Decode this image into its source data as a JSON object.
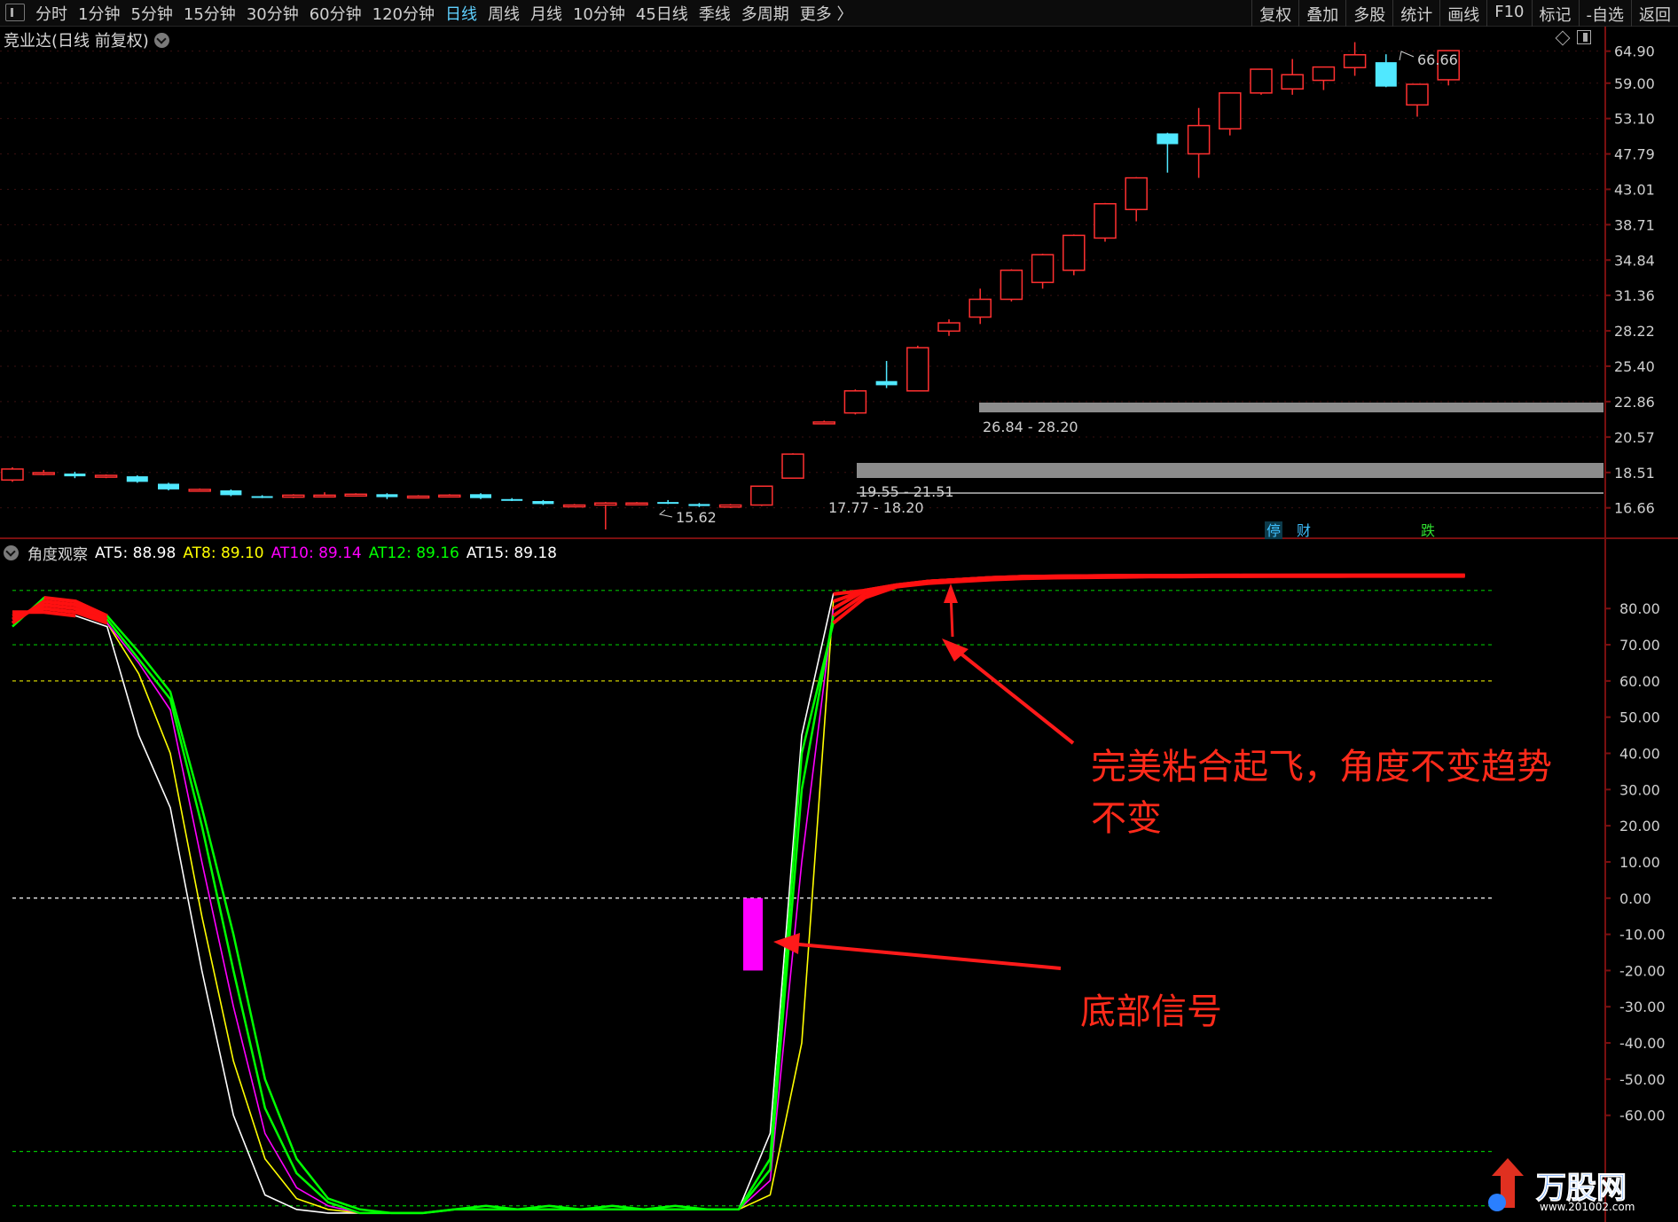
{
  "toolbar": {
    "periods": [
      "分时",
      "1分钟",
      "5分钟",
      "15分钟",
      "30分钟",
      "60分钟",
      "120分钟",
      "日线",
      "周线",
      "月线",
      "10分钟",
      "45日线",
      "季线",
      "多周期",
      "更多 〉"
    ],
    "active_period": "日线",
    "tools": [
      "复权",
      "叠加",
      "多股",
      "统计",
      "画线",
      "F10",
      "标记",
      "-自选",
      "返回"
    ]
  },
  "stock": {
    "name": "竞业达",
    "mode": "(日线 前复权)"
  },
  "price_axis": {
    "ticks": [
      "64.90",
      "59.00",
      "53.10",
      "47.79",
      "43.01",
      "38.71",
      "34.84",
      "31.36",
      "28.22",
      "25.40",
      "22.86",
      "20.57",
      "18.51",
      "16.66"
    ]
  },
  "price_annotations": {
    "high_label": "66.66",
    "low_label": "15.62",
    "gap1": "26.84 - 28.20",
    "gap2": "19.55 - 21.51",
    "gap3": "17.77 - 18.20"
  },
  "event_tags": {
    "tag1": "停",
    "tag2": "财",
    "tag3": "跌"
  },
  "indicator": {
    "name": "角度观察",
    "at5": "AT5: 88.98",
    "at8": "AT8: 89.10",
    "at10": "AT10: 89.14",
    "at12": "AT12: 89.16",
    "at15": "AT15: 89.18",
    "colors": {
      "at5": "#ffffff",
      "at8": "#ffff00",
      "at10": "#ff00ff",
      "at12": "#00ff00",
      "at15": "#ffffff"
    },
    "ticks": [
      "80.00",
      "70.00",
      "60.00",
      "50.00",
      "40.00",
      "30.00",
      "20.00",
      "10.00",
      "0.00",
      "-10.00",
      "-20.00",
      "-30.00",
      "-40.00",
      "-50.00",
      "-60.00"
    ]
  },
  "annotations": {
    "flight_line1": "完美粘合起飞，角度不变趋势",
    "flight_line2": "不变",
    "bottom_signal": "底部信号"
  },
  "logo": {
    "name": "万股网",
    "url": "www.201002.com"
  },
  "chart_data": [
    {
      "type": "candlestick",
      "title": "竞业达(日线 前复权)",
      "ylim": [
        15.5,
        68
      ],
      "y_scale": "log",
      "candles": [
        {
          "o": 18.1,
          "c": 18.7,
          "h": 18.8,
          "l": 18.0
        },
        {
          "o": 18.5,
          "c": 18.5,
          "h": 18.65,
          "l": 18.35
        },
        {
          "o": 18.45,
          "c": 18.3,
          "h": 18.55,
          "l": 18.2
        },
        {
          "o": 18.3,
          "c": 18.35,
          "h": 18.4,
          "l": 18.2
        },
        {
          "o": 18.3,
          "c": 18.0,
          "h": 18.35,
          "l": 17.95
        },
        {
          "o": 17.9,
          "c": 17.6,
          "h": 17.95,
          "l": 17.55
        },
        {
          "o": 17.55,
          "c": 17.6,
          "h": 17.65,
          "l": 17.5
        },
        {
          "o": 17.55,
          "c": 17.3,
          "h": 17.6,
          "l": 17.25
        },
        {
          "o": 17.25,
          "c": 17.2,
          "h": 17.3,
          "l": 17.15
        },
        {
          "o": 17.2,
          "c": 17.3,
          "h": 17.35,
          "l": 17.15
        },
        {
          "o": 17.3,
          "c": 17.3,
          "h": 17.45,
          "l": 17.2
        },
        {
          "o": 17.3,
          "c": 17.35,
          "h": 17.4,
          "l": 17.25
        },
        {
          "o": 17.35,
          "c": 17.2,
          "h": 17.4,
          "l": 17.1
        },
        {
          "o": 17.2,
          "c": 17.25,
          "h": 17.3,
          "l": 17.15
        },
        {
          "o": 17.25,
          "c": 17.3,
          "h": 17.35,
          "l": 17.2
        },
        {
          "o": 17.35,
          "c": 17.15,
          "h": 17.4,
          "l": 17.1
        },
        {
          "o": 17.1,
          "c": 17.05,
          "h": 17.15,
          "l": 17.0
        },
        {
          "o": 17.0,
          "c": 16.85,
          "h": 17.05,
          "l": 16.8
        },
        {
          "o": 16.8,
          "c": 16.8,
          "h": 16.85,
          "l": 16.75
        },
        {
          "o": 16.8,
          "c": 16.9,
          "h": 16.95,
          "l": 15.62
        },
        {
          "o": 16.9,
          "c": 16.9,
          "h": 16.95,
          "l": 16.8
        },
        {
          "o": 16.95,
          "c": 16.9,
          "h": 17.05,
          "l": 16.85
        },
        {
          "o": 16.85,
          "c": 16.75,
          "h": 16.9,
          "l": 16.7
        },
        {
          "o": 16.7,
          "c": 16.8,
          "h": 16.85,
          "l": 16.65
        },
        {
          "o": 16.8,
          "c": 17.77,
          "h": 17.8,
          "l": 16.75
        },
        {
          "o": 18.2,
          "c": 19.55,
          "h": 19.6,
          "l": 18.2
        },
        {
          "o": 21.51,
          "c": 21.51,
          "h": 21.6,
          "l": 21.4
        },
        {
          "o": 22.1,
          "c": 23.6,
          "h": 23.7,
          "l": 22.0
        },
        {
          "o": 24.3,
          "c": 24.0,
          "h": 25.8,
          "l": 23.8
        },
        {
          "o": 23.6,
          "c": 26.84,
          "h": 27.0,
          "l": 23.6
        },
        {
          "o": 28.2,
          "c": 28.9,
          "h": 29.2,
          "l": 27.8
        },
        {
          "o": 29.4,
          "c": 31.0,
          "h": 32.0,
          "l": 28.8
        },
        {
          "o": 31.0,
          "c": 33.8,
          "h": 33.9,
          "l": 30.8
        },
        {
          "o": 32.6,
          "c": 35.4,
          "h": 35.5,
          "l": 32.0
        },
        {
          "o": 33.8,
          "c": 37.5,
          "h": 37.6,
          "l": 33.3
        },
        {
          "o": 37.2,
          "c": 41.2,
          "h": 41.3,
          "l": 36.8
        },
        {
          "o": 40.5,
          "c": 44.5,
          "h": 44.6,
          "l": 39.1
        },
        {
          "o": 50.8,
          "c": 49.2,
          "h": 50.9,
          "l": 45.2
        },
        {
          "o": 47.8,
          "c": 52.0,
          "h": 54.8,
          "l": 44.5
        },
        {
          "o": 51.5,
          "c": 57.3,
          "h": 57.4,
          "l": 50.5
        },
        {
          "o": 57.3,
          "c": 61.5,
          "h": 61.6,
          "l": 57.0
        },
        {
          "o": 58.0,
          "c": 60.5,
          "h": 63.4,
          "l": 57.0
        },
        {
          "o": 59.5,
          "c": 61.9,
          "h": 62.0,
          "l": 57.8
        },
        {
          "o": 61.8,
          "c": 64.2,
          "h": 66.66,
          "l": 60.3
        },
        {
          "o": 62.8,
          "c": 58.4,
          "h": 64.3,
          "l": 58.3
        },
        {
          "o": 55.3,
          "c": 58.8,
          "h": 58.9,
          "l": 53.4
        },
        {
          "o": 59.6,
          "c": 65.0,
          "h": 65.1,
          "l": 58.6
        }
      ]
    },
    {
      "type": "line",
      "title": "角度观察",
      "ylim": [
        -88,
        95
      ],
      "reference_lines": [
        85,
        70,
        60,
        0,
        -70,
        -85
      ],
      "series": [
        {
          "name": "AT5",
          "color": "#ffffff",
          "values": [
            79,
            79,
            78,
            75,
            45,
            25,
            -20,
            -60,
            -82,
            -86,
            -87,
            -87,
            -87,
            -87,
            -86,
            -86,
            -86,
            -86,
            -86,
            -86,
            -86,
            -86,
            -86,
            -86,
            -65,
            45,
            84,
            85,
            86,
            87,
            87.5,
            88,
            88.3,
            88.5,
            88.6,
            88.7,
            88.8,
            88.8,
            88.9,
            88.9,
            88.95,
            88.95,
            88.96,
            88.97,
            88.97,
            88.98,
            88.98
          ]
        },
        {
          "name": "AT8",
          "color": "#ffff00",
          "values": [
            78,
            80,
            79,
            76,
            62,
            40,
            -5,
            -45,
            -72,
            -83,
            -86,
            -87,
            -87,
            -87,
            -86,
            -86,
            -86,
            -86,
            -86,
            -86,
            -86,
            -86,
            -86,
            -86,
            -82,
            -40,
            82,
            85,
            86.5,
            87.5,
            88,
            88.5,
            88.7,
            88.8,
            88.9,
            89.0,
            89.0,
            89.05,
            89.05,
            89.1,
            89.1,
            89.1,
            89.1,
            89.1,
            89.1,
            89.1,
            89.1
          ]
        },
        {
          "name": "AT10",
          "color": "#ff00ff",
          "values": [
            77,
            81,
            80,
            76,
            65,
            52,
            10,
            -30,
            -65,
            -80,
            -85,
            -87,
            -87,
            -87,
            -86,
            -86,
            -86,
            -86,
            -86,
            -86,
            -86,
            -86,
            -86,
            -86,
            -78,
            10,
            80,
            85,
            86.5,
            87.5,
            88,
            88.5,
            88.8,
            88.9,
            89.0,
            89.05,
            89.1,
            89.1,
            89.1,
            89.12,
            89.12,
            89.13,
            89.13,
            89.14,
            89.14,
            89.14,
            89.14
          ]
        },
        {
          "name": "AT12",
          "color": "#00ff00",
          "values": [
            76,
            82,
            81,
            77,
            66,
            55,
            20,
            -20,
            -58,
            -76,
            -84,
            -87,
            -87,
            -87,
            -86,
            -86,
            -86,
            -86,
            -86,
            -86,
            -86,
            -86,
            -86,
            -86,
            -75,
            30,
            78,
            84,
            86,
            87.5,
            88,
            88.5,
            88.8,
            88.9,
            89.0,
            89.05,
            89.1,
            89.12,
            89.14,
            89.15,
            89.15,
            89.16,
            89.16,
            89.16,
            89.16,
            89.16,
            89.16
          ]
        },
        {
          "name": "AT15",
          "color": "#00ff00",
          "values": [
            75,
            83,
            82,
            78,
            68,
            57,
            25,
            -10,
            -50,
            -72,
            -83,
            -86,
            -87,
            -87,
            -86,
            -85,
            -86,
            -85,
            -86,
            -85,
            -86,
            -85,
            -86,
            -86,
            -72,
            40,
            76,
            83,
            86,
            87.5,
            88,
            88.5,
            88.8,
            88.9,
            89.0,
            89.05,
            89.1,
            89.12,
            89.14,
            89.16,
            89.17,
            89.17,
            89.18,
            89.18,
            89.18,
            89.18,
            89.18
          ]
        }
      ],
      "signal_bar": {
        "label": "底部信号",
        "from": 0,
        "to": -20
      }
    }
  ]
}
